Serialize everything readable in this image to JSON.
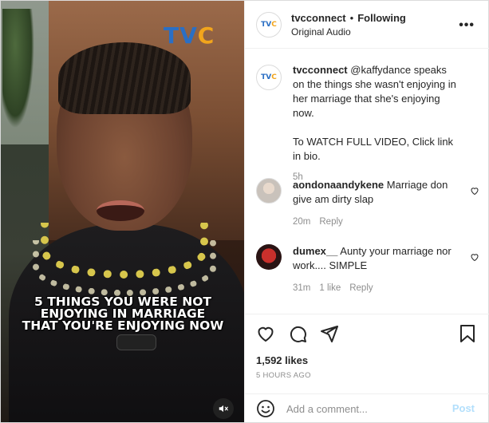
{
  "media": {
    "logo": {
      "t": "T",
      "v": "V",
      "c": "C"
    },
    "caption": [
      "5 THINGS YOU WERE NOT",
      "ENJOYING IN MARRIAGE",
      "THAT YOU'RE ENJOYING NOW"
    ],
    "mute_icon": "speaker-muted-icon"
  },
  "header": {
    "username": "tvcconnect",
    "separator": "•",
    "follow_label": "Following",
    "audio": "Original Audio",
    "more_label": "•••"
  },
  "post_caption": {
    "username": "tvcconnect",
    "mention": "@kaffydance",
    "text1": " speaks on the things she wasn't enjoying in her marriage that she's enjoying now.",
    "text2": "To WATCH FULL VIDEO, Click link in bio.",
    "time": "5h"
  },
  "comments": [
    {
      "username": "aondonaandykene",
      "text": "Marriage don give am dirty slap",
      "time": "20m",
      "likes": "",
      "reply": "Reply"
    },
    {
      "username": "dumex__",
      "text": "Aunty your marriage nor work.... SIMPLE",
      "time": "31m",
      "likes": "1 like",
      "reply": "Reply"
    }
  ],
  "stats": {
    "likes": "1,592 likes",
    "posted": "5 HOURS AGO"
  },
  "add_comment": {
    "placeholder": "Add a comment...",
    "post_label": "Post"
  },
  "colors": {
    "accent_blue": "#2b6fc4",
    "accent_orange": "#f2a51c",
    "post_disabled": "#b2dffc",
    "muted_text": "#8e8e8e"
  }
}
